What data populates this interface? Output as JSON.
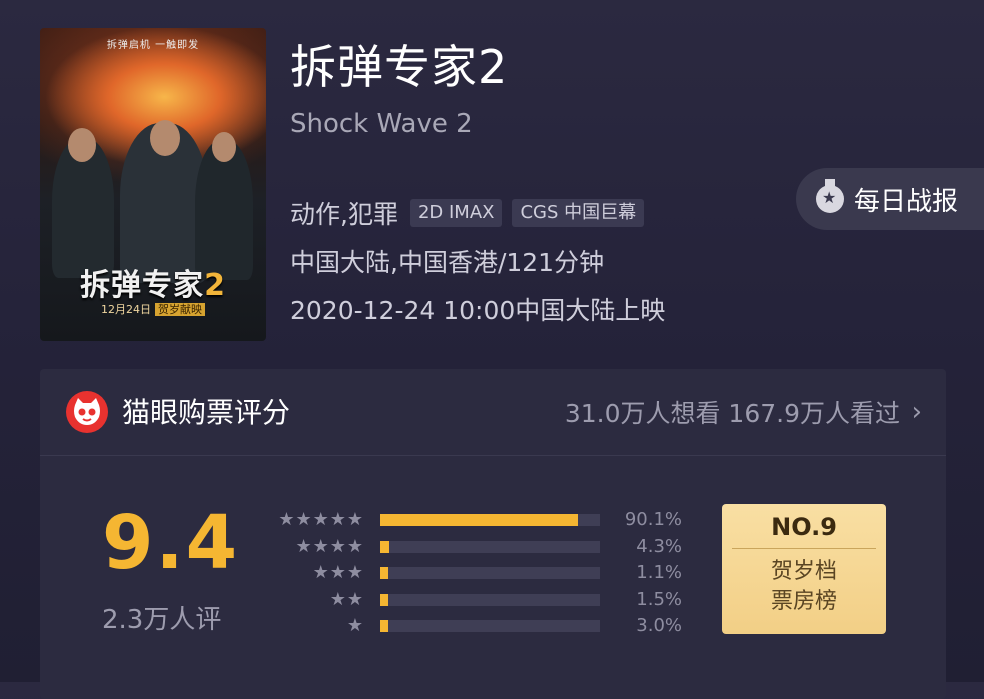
{
  "movie": {
    "title_cn": "拆弹专家2",
    "title_en": "Shock Wave 2",
    "genre": "动作,犯罪",
    "formats": [
      "2D IMAX",
      "CGS 中国巨幕"
    ],
    "region_duration": "中国大陆,中国香港/121分钟",
    "release": "2020-12-24 10:00中国大陆上映"
  },
  "poster": {
    "tagline": "拆弹启机 一触即发",
    "title_main": "拆弹专家",
    "title_num": "2",
    "date": "12月24日",
    "date_tag": "贺岁献映"
  },
  "daily_report": {
    "label": "每日战报",
    "icon": "medal-icon"
  },
  "rating_card": {
    "title": "猫眼购票评分",
    "stats": "31.0万人想看 167.9万人看过",
    "score": "9.4",
    "count": "2.3万人评",
    "distribution": [
      {
        "stars": "★★★★★",
        "pct_label": "90.1%",
        "value": 90.1
      },
      {
        "stars": "★★★★",
        "pct_label": "4.3%",
        "value": 4.3
      },
      {
        "stars": "★★★",
        "pct_label": "1.1%",
        "value": 1.1
      },
      {
        "stars": "★★",
        "pct_label": "1.5%",
        "value": 1.5
      },
      {
        "stars": "★",
        "pct_label": "3.0%",
        "value": 3.0
      }
    ],
    "rank": {
      "no": "NO.9",
      "line1": "贺岁档",
      "line2": "票房榜"
    }
  },
  "colors": {
    "accent": "#f5b632",
    "background": "#25233a",
    "card": "#2c2b40",
    "logo_red": "#e8322f"
  }
}
